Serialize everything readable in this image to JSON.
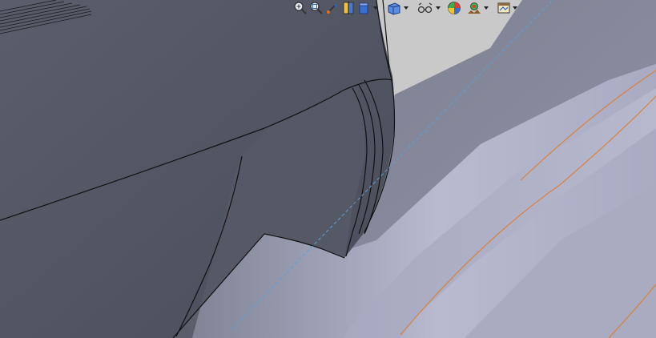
{
  "viewport": {
    "background_color": "#c9c9c9",
    "colors": {
      "dark_body": "#545864",
      "dark_body_shade": "#4c505c",
      "mid_face": "#7d8190",
      "light_face": "#b4b6cc",
      "edge_line": "#111111",
      "orange_edge": "#d9823b",
      "axis_dash": "#5aa0d8"
    }
  },
  "heads_up_toolbar": {
    "items": [
      {
        "name": "zoom-to-fit-icon",
        "has_dropdown": false
      },
      {
        "name": "zoom-to-area-icon",
        "has_dropdown": false
      },
      {
        "name": "previous-view-icon",
        "has_dropdown": false
      },
      {
        "name": "section-view-icon",
        "has_dropdown": false
      },
      {
        "name": "view-orientation-icon",
        "has_dropdown": true
      },
      {
        "name": "display-style-icon",
        "has_dropdown": true
      },
      {
        "name": "hide-show-items-icon",
        "has_dropdown": true
      },
      {
        "name": "edit-appearance-icon",
        "has_dropdown": false
      },
      {
        "name": "apply-scene-icon",
        "has_dropdown": true
      },
      {
        "name": "view-settings-icon",
        "has_dropdown": true
      }
    ]
  }
}
